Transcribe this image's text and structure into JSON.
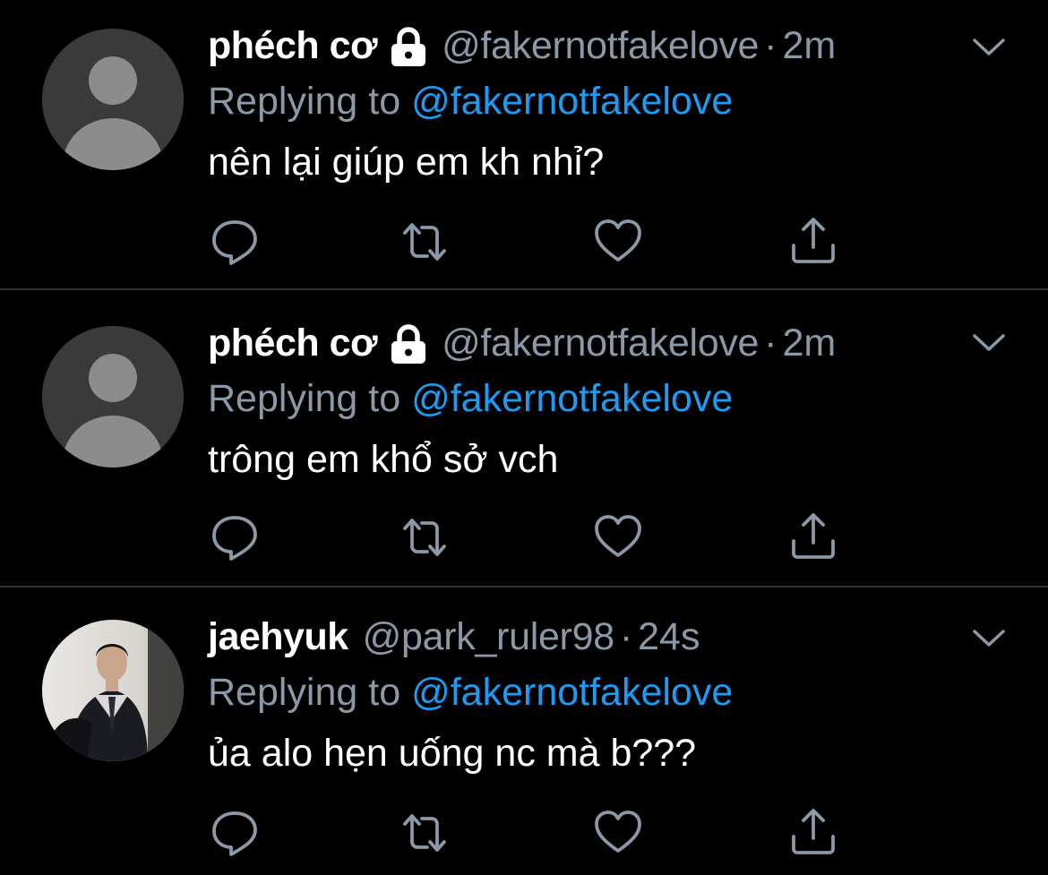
{
  "colors": {
    "background": "#000000",
    "divider": "#2f3336",
    "name": "#ffffff",
    "secondary": "#8b98a5",
    "link": "#1d9bf0",
    "icon": "#8b98a5"
  },
  "tweets": [
    {
      "name": "phéch cơ",
      "protected": true,
      "handle": "@fakernotfakelove",
      "separator": "·",
      "time": "2m",
      "reply_label": "Replying to",
      "reply_target": "@fakernotfakelove",
      "text": "nên lại giúp em kh nhỉ?",
      "avatar": "default-avatar"
    },
    {
      "name": "phéch cơ",
      "protected": true,
      "handle": "@fakernotfakelove",
      "separator": "·",
      "time": "2m",
      "reply_label": "Replying to",
      "reply_target": "@fakernotfakelove",
      "text": "trông em khổ sở vch",
      "avatar": "default-avatar"
    },
    {
      "name": "jaehyuk",
      "protected": false,
      "handle": "@park_ruler98",
      "separator": "·",
      "time": "24s",
      "reply_label": "Replying to",
      "reply_target": "@fakernotfakelove",
      "text": "ủa alo hẹn uống nc mà b???",
      "avatar": "photo-avatar"
    }
  ],
  "icons": {
    "reply": "reply-icon",
    "retweet": "retweet-icon",
    "like": "like-icon",
    "share": "share-icon",
    "more": "chevron-down-icon",
    "lock": "lock-icon"
  }
}
